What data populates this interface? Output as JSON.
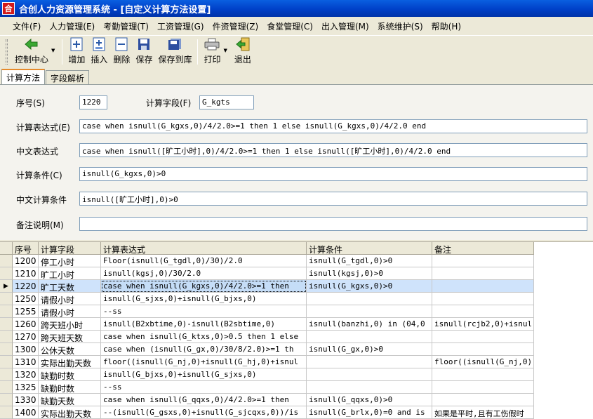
{
  "window": {
    "icon_text": "合",
    "title": "合创人力资源管理系统 - [自定义计算方法设置]"
  },
  "menu": [
    "文件(F)",
    "人力管理(E)",
    "考勤管理(T)",
    "工资管理(G)",
    "件资管理(Z)",
    "食堂管理(C)",
    "出入管理(M)",
    "系统维护(S)",
    "帮助(H)"
  ],
  "toolbar": {
    "control_center": "控制中心",
    "add": "增加",
    "insert": "插入",
    "delete": "删除",
    "save": "保存",
    "save_to_lib": "保存到库",
    "print": "打印",
    "exit": "退出"
  },
  "tabs": {
    "calc_method": "计算方法",
    "field_parse": "字段解析"
  },
  "form": {
    "seq_label": "序号(S)",
    "seq_value": "1220",
    "field_label": "计算字段(F)",
    "field_value": "G_kgts",
    "expr_label": "计算表达式(E)",
    "expr_value": "case when isnull(G_kgxs,0)/4/2.0>=1 then 1 else isnull(G_kgxs,0)/4/2.0 end",
    "cn_expr_label": "中文表达式",
    "cn_expr_value": "case when isnull([旷工小时],0)/4/2.0>=1 then 1 else isnull([旷工小时],0)/4/2.0 end",
    "cond_label": "计算条件(C)",
    "cond_value": "isnull(G_kgxs,0)>0",
    "cn_cond_label": "中文计算条件",
    "cn_cond_value": "isnull([旷工小时],0)>0",
    "remark_label": "备注说明(M)",
    "remark_value": ""
  },
  "grid": {
    "columns": [
      "序号",
      "计算字段",
      "计算表达式",
      "计算条件",
      "备注"
    ],
    "selected_marker": "▶",
    "rows": [
      [
        "1200",
        "停工小时",
        "Floor(isnull(G_tgdl,0)/30)/2.0",
        "isnull(G_tgdl,0)>0",
        ""
      ],
      [
        "1210",
        "旷工小时",
        "isnull(kgsj,0)/30/2.0",
        "isnull(kgsj,0)>0",
        ""
      ],
      [
        "1220",
        "旷工天数",
        "case when isnull(G_kgxs,0)/4/2.0>=1 then",
        "isnull(G_kgxs,0)>0",
        ""
      ],
      [
        "1250",
        "请假小时",
        "isnull(G_sjxs,0)+isnull(G_bjxs,0)",
        "",
        ""
      ],
      [
        "1255",
        "请假小时",
        "--ss",
        "",
        ""
      ],
      [
        "1260",
        "跨天班小时",
        "isnull(B2xbtime,0)-isnull(B2sbtime,0)",
        "isnull(banzhi,0) in (04,0",
        "isnull(rcjb2,0)+isnul"
      ],
      [
        "1270",
        "跨天班天数",
        "case when isnull(G_ktxs,0)>0.5 then 1 else",
        "",
        ""
      ],
      [
        "1300",
        "公休天数",
        "case when (isnull(G_gx,0)/30/8/2.0)>=1 th",
        "isnull(G_gx,0)>0",
        ""
      ],
      [
        "1310",
        "实际出勤天数",
        "floor((isnull(G_nj,0)+isnull(G_hj,0)+isnul",
        "",
        "floor((isnull(G_nj,0)"
      ],
      [
        "1320",
        "缺勤时数",
        "isnull(G_bjxs,0)+isnull(G_sjxs,0)",
        "",
        ""
      ],
      [
        "1325",
        "缺勤时数",
        "--ss",
        "",
        ""
      ],
      [
        "1330",
        "缺勤天数",
        "case when isnull(G_qqxs,0)/4/2.0>=1 then",
        "isnull(G_qqxs,0)>0",
        ""
      ],
      [
        "1400",
        "实际出勤天数",
        "--(isnull(G_gsxs,0)+isnull(G_sjcqxs,0))/is",
        "isnull(G_brlx,0)=0 and is",
        "如果是平时,且有工伤假时"
      ]
    ]
  }
}
